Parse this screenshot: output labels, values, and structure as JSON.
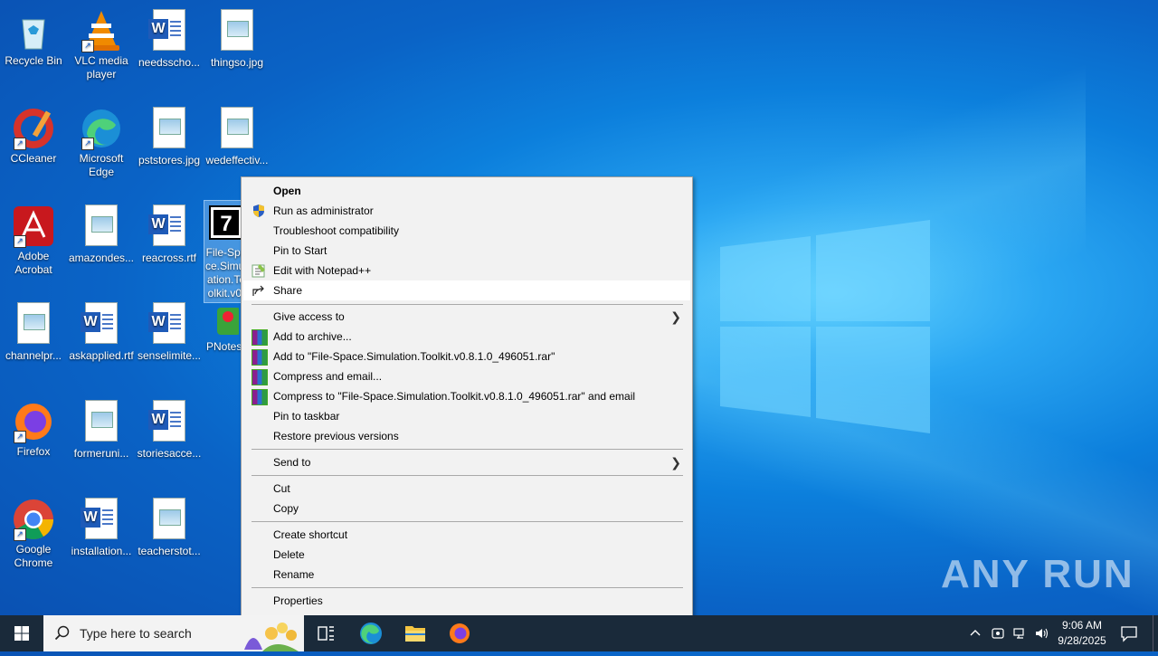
{
  "desktop": {
    "icons": [
      {
        "label": "Recycle Bin"
      },
      {
        "label": "VLC media player"
      },
      {
        "label": "needsscho..."
      },
      {
        "label": "thingso.jpg"
      },
      {
        "label": "CCleaner"
      },
      {
        "label": "Microsoft Edge"
      },
      {
        "label": "pststores.jpg"
      },
      {
        "label": "wedeffectiv..."
      },
      {
        "label": "Adobe Acrobat"
      },
      {
        "label": "amazondes..."
      },
      {
        "label": "reacross.rtf"
      },
      {
        "label": "File-Space.Simulation.Toolkit.v0.8.1.0_496051"
      },
      {
        "label": "channelpr..."
      },
      {
        "label": "askapplied.rtf"
      },
      {
        "label": "senselimite..."
      },
      {
        "label": "PNotes"
      },
      {
        "label": "Firefox"
      },
      {
        "label": "formeruni..."
      },
      {
        "label": "storiesacce..."
      },
      {
        "label": "Google Chrome"
      },
      {
        "label": "installation..."
      },
      {
        "label": "teacherstot..."
      }
    ]
  },
  "context_menu": {
    "items": [
      {
        "label": "Open"
      },
      {
        "label": "Run as administrator"
      },
      {
        "label": "Troubleshoot compatibility"
      },
      {
        "label": "Pin to Start"
      },
      {
        "label": "Edit with Notepad++"
      },
      {
        "label": "Share"
      },
      {
        "label": "Give access to"
      },
      {
        "label": "Add to archive..."
      },
      {
        "label": "Add to \"File-Space.Simulation.Toolkit.v0.8.1.0_496051.rar\""
      },
      {
        "label": "Compress and email..."
      },
      {
        "label": "Compress to \"File-Space.Simulation.Toolkit.v0.8.1.0_496051.rar\" and email"
      },
      {
        "label": "Pin to taskbar"
      },
      {
        "label": "Restore previous versions"
      },
      {
        "label": "Send to"
      },
      {
        "label": "Cut"
      },
      {
        "label": "Copy"
      },
      {
        "label": "Create shortcut"
      },
      {
        "label": "Delete"
      },
      {
        "label": "Rename"
      },
      {
        "label": "Properties"
      }
    ]
  },
  "taskbar": {
    "search_placeholder": "Type here to search",
    "time": "9:06 AM",
    "date": "9/28/2025"
  },
  "watermark": "ANY RUN",
  "colors": {
    "menu_bg": "#f2f2f2",
    "taskbar_bg": "#1a2a3a",
    "accent": "#0a63c6"
  }
}
